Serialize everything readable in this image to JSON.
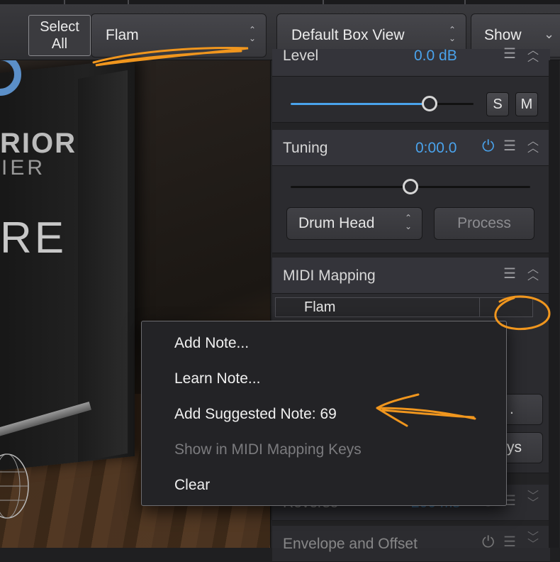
{
  "toolbar": {
    "select_all_label": "Select\nAll",
    "piece_select_value": "Flam",
    "view_select_value": "Default Box View",
    "show_select_value": "Show"
  },
  "stage": {
    "banner_text_1": "RIOR",
    "banner_text_2": "IER",
    "banner_text_3": "RE"
  },
  "panel": {
    "level": {
      "label": "Level",
      "value": "0.0 dB",
      "level_fraction": 0.76,
      "solo_label": "S",
      "mute_label": "M"
    },
    "tuning": {
      "label": "Tuning",
      "value": "0:00.0",
      "position_fraction": 0.5,
      "drum_head_value": "Drum Head",
      "process_label": "Process"
    },
    "midi_mapping": {
      "label": "MIDI Mapping",
      "row_label": "Flam",
      "btn1_partial": ".",
      "btn2_partial": "ys"
    },
    "reverse": {
      "label": "Reverse",
      "value": "200 ms"
    },
    "envelope": {
      "label": "Envelope and Offset"
    }
  },
  "context_menu": {
    "items": [
      {
        "label": "Add Note...",
        "enabled": true
      },
      {
        "label": "Learn Note...",
        "enabled": true
      },
      {
        "label": "Add Suggested Note: 69",
        "enabled": true
      },
      {
        "label": "Show in MIDI Mapping Keys",
        "enabled": false
      },
      {
        "label": "Clear",
        "enabled": true
      }
    ]
  },
  "colors": {
    "accent_blue": "#4aa3ec",
    "annotation_orange": "#f0961e",
    "panel_bg": "#232325"
  },
  "icons": {
    "updown": "updown-chevron-icon",
    "menu": "hamburger-menu-icon",
    "collapse": "collapse-chevron-icon",
    "power": "power-icon"
  }
}
